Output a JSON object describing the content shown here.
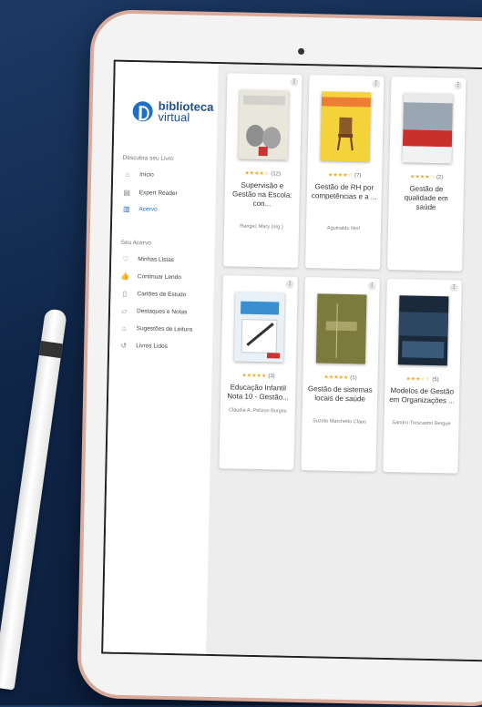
{
  "brand": {
    "line1": "biblioteca",
    "line2": "virtual",
    "color": "#1f6fc4"
  },
  "sidebar": {
    "discover_label": "Descubra seu Livro",
    "discover_items": [
      {
        "label": "Início",
        "icon": "home-icon"
      },
      {
        "label": "Expert Reader",
        "icon": "grid-icon"
      },
      {
        "label": "Acervo",
        "icon": "library-icon",
        "active": true
      }
    ],
    "collection_label": "Seu Acervo",
    "collection_items": [
      {
        "label": "Minhas Listas",
        "icon": "heart-icon"
      },
      {
        "label": "Continuar Lendo",
        "icon": "thumbs-up-icon"
      },
      {
        "label": "Cartões de Estudo",
        "icon": "cards-icon"
      },
      {
        "label": "Destaques e Notas",
        "icon": "note-icon"
      },
      {
        "label": "Sugestões de Leitura",
        "icon": "lightbulb-icon"
      },
      {
        "label": "Livros Lidos",
        "icon": "history-icon"
      }
    ]
  },
  "books": [
    {
      "title": "Supervisão e Gestão na Escola: con...",
      "author": "Rangel, Mary (org.)",
      "rating": 4,
      "count": "(12)",
      "cover_color": "#e9e6dc"
    },
    {
      "title": "Gestão de RH por competências e a ...",
      "author": "Aguinaldo Neri",
      "rating": 4,
      "count": "(7)",
      "cover_color": "#f3d23a"
    },
    {
      "title": "Gestão de qualidade em saúde",
      "author": "",
      "rating": 4,
      "count": "(2)",
      "cover_color": "#c9302c"
    },
    {
      "title": "Educação Infantil Nota 10 - Gestão...",
      "author": "Cláudia A. Pelizon Borges",
      "rating": 5,
      "count": "(3)",
      "cover_color": "#e8f1f7"
    },
    {
      "title": "Gestão de sistemas locais de saúde",
      "author": "Suzete Marchetto Claus",
      "rating": 5,
      "count": "(1)",
      "cover_color": "#7d7a3e"
    },
    {
      "title": "Modelos de Gestão em Organizações ...",
      "author": "Sandro Trescastro Bergue",
      "rating": 3,
      "count": "(5)",
      "cover_color": "#1b2a3a"
    }
  ]
}
